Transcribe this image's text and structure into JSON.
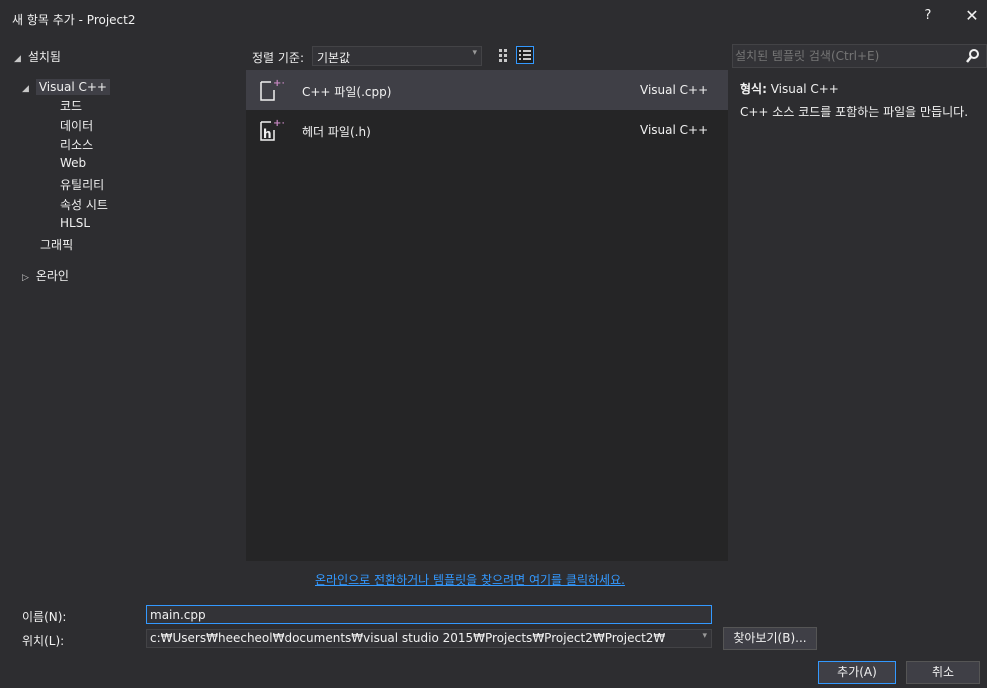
{
  "window": {
    "title": "새 항목 추가 - Project2",
    "help": "?",
    "close": "✕"
  },
  "tree": {
    "installed": "설치됨",
    "visual_cpp": "Visual C++",
    "children": [
      "코드",
      "데이터",
      "리소스",
      "Web",
      "유틸리티",
      "속성 시트",
      "HLSL"
    ],
    "graphics": "그래픽",
    "online": "온라인"
  },
  "sort": {
    "label": "정렬 기준:",
    "value": "기본값"
  },
  "search": {
    "placeholder": "설치된 템플릿 검색(Ctrl+E)"
  },
  "templates": [
    {
      "name": "C++ 파일(.cpp)",
      "lang": "Visual C++"
    },
    {
      "name": "헤더 파일(.h)",
      "lang": "Visual C++"
    }
  ],
  "description": {
    "type_label": "형식:",
    "type_value": "Visual C++",
    "text": "C++ 소스 코드를 포함하는 파일을 만듭니다."
  },
  "online_link": "온라인으로 전환하거나 템플릿을 찾으려면 여기를 클릭하세요.",
  "form": {
    "name_label": "이름(N):",
    "name_value": "main.cpp",
    "location_label": "위치(L):",
    "location_value": "c:₩Users₩heecheol₩documents₩visual studio 2015₩Projects₩Project2₩Project2₩",
    "browse": "찾아보기(B)...",
    "add": "추가(A)",
    "cancel": "취소"
  },
  "colors": {
    "accent": "#3399ff",
    "background": "#2d2d30",
    "list_bg": "#252526",
    "selection": "#3f3f46"
  }
}
